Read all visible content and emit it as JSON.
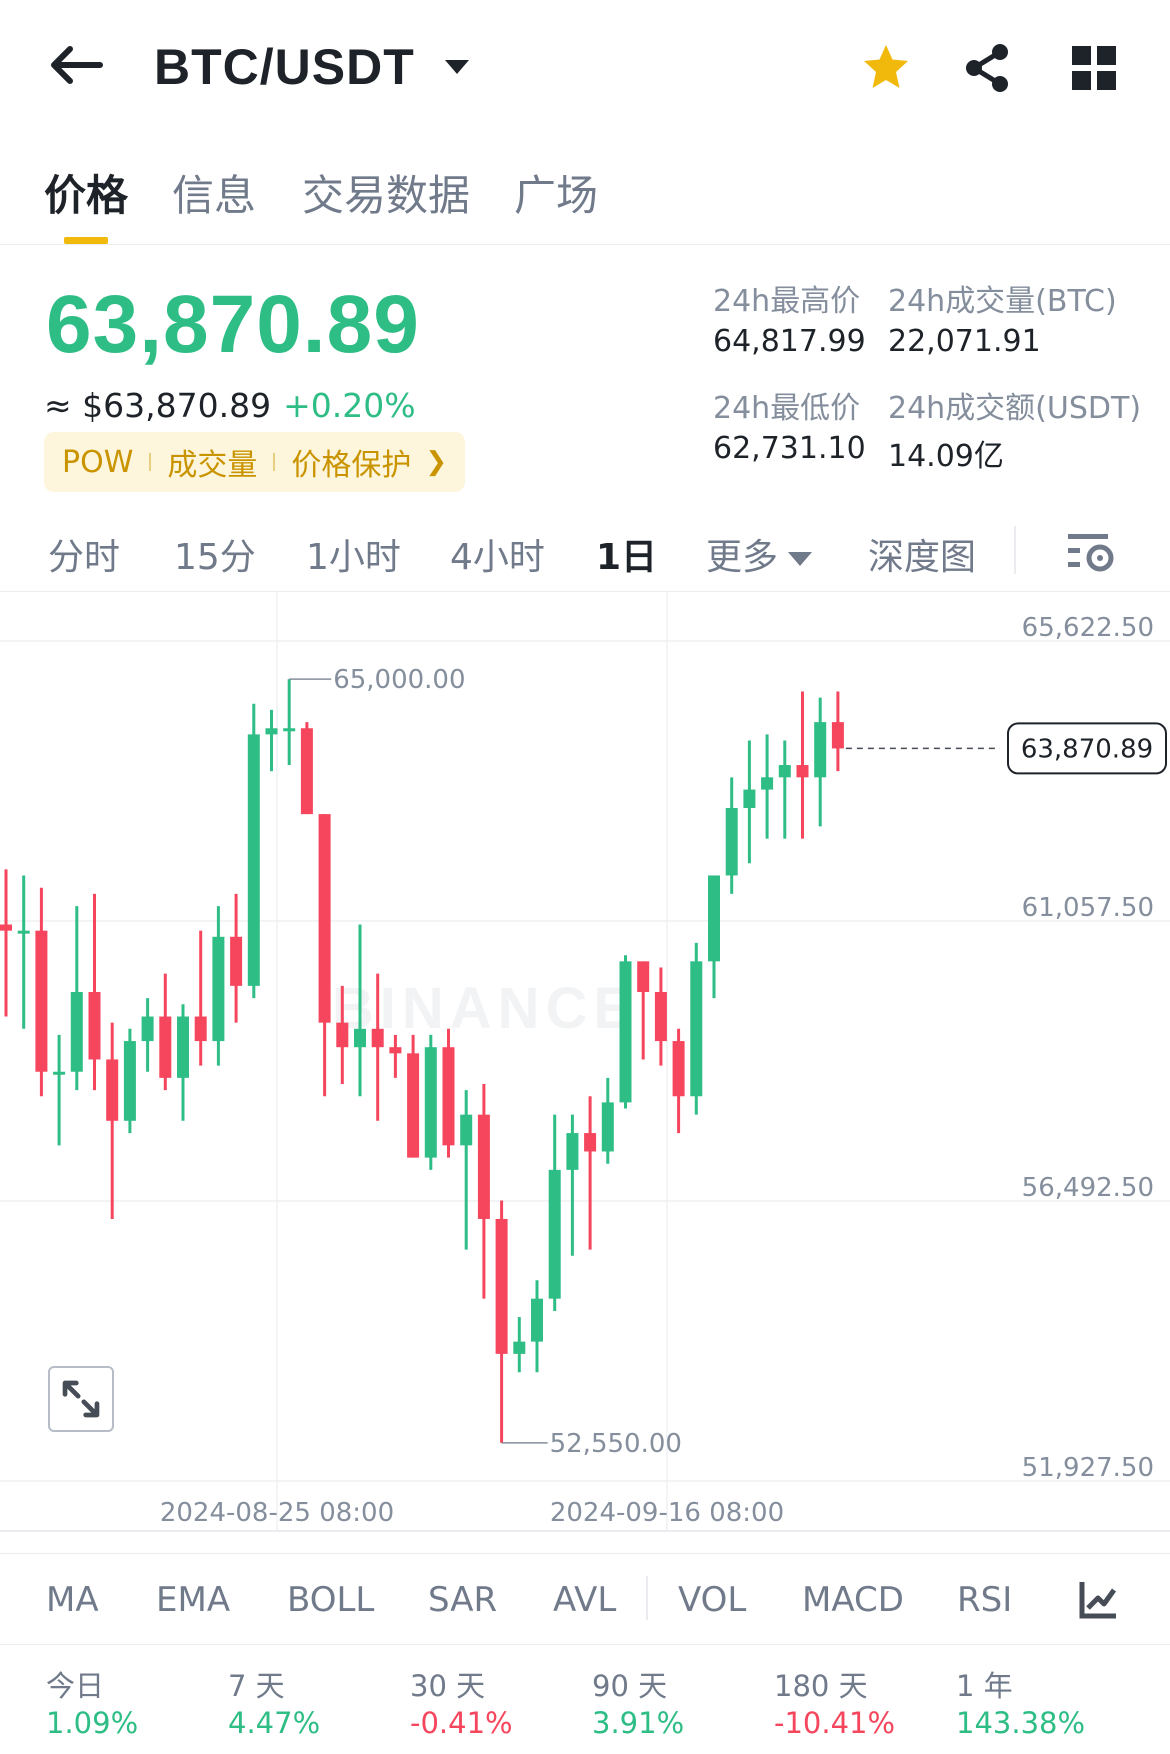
{
  "header": {
    "pair": "BTC/USDT",
    "icons": [
      "back-arrow-icon",
      "caret-down-icon",
      "star-icon",
      "share-icon",
      "grid-icon"
    ],
    "star_color": "#f0b90b"
  },
  "tabs": [
    {
      "label": "价格",
      "active": true
    },
    {
      "label": "信息",
      "active": false
    },
    {
      "label": "交易数据",
      "active": false
    },
    {
      "label": "广场",
      "active": false
    }
  ],
  "price": {
    "last": "63,870.89",
    "fiat": "≈ $63,870.89",
    "change": "+0.20%",
    "tags": [
      "POW",
      "成交量",
      "价格保护"
    ]
  },
  "stats": {
    "high_label": "24h最高价",
    "high_value": "64,817.99",
    "vol_btc_label": "24h成交量(BTC)",
    "vol_btc_value": "22,071.91",
    "low_label": "24h最低价",
    "low_value": "62,731.10",
    "vol_usdt_label": "24h成交额(USDT)",
    "vol_usdt_value": "14.09亿"
  },
  "intervals": [
    "分时",
    "15分",
    "1小时",
    "4小时",
    "1日",
    "更多",
    "深度图"
  ],
  "active_interval": "1日",
  "colors": {
    "up": "#2ebd85",
    "down": "#f6465d",
    "accent": "#f0b90b"
  },
  "chart": {
    "watermark": "BINANCE",
    "price_labels": [
      "65,622.50",
      "61,057.50",
      "56,492.50",
      "51,927.50"
    ],
    "date_labels": [
      "2024-08-25 08:00",
      "2024-09-16 08:00"
    ],
    "high_marker": "65,000.00",
    "low_marker": "52,550.00",
    "current_price": "63,870.89"
  },
  "chart_data": {
    "type": "candlestick",
    "interval": "1日",
    "ylim": [
      51927.5,
      65622.5
    ],
    "y_ticks": [
      65622.5,
      61057.5,
      56492.5,
      51927.5
    ],
    "x_ticks": [
      "2024-08-25 08:00",
      "2024-09-16 08:00"
    ],
    "high_annotation": 65000.0,
    "low_annotation": 52550.0,
    "last_price": 63870.89,
    "candles": [
      {
        "o": 61000,
        "h": 61900,
        "l": 59500,
        "c": 60900
      },
      {
        "o": 60900,
        "h": 61800,
        "l": 59300,
        "c": 60900
      },
      {
        "o": 60900,
        "h": 61600,
        "l": 58200,
        "c": 58600
      },
      {
        "o": 58600,
        "h": 59200,
        "l": 57400,
        "c": 58600
      },
      {
        "o": 58600,
        "h": 61300,
        "l": 58300,
        "c": 59900
      },
      {
        "o": 59900,
        "h": 61500,
        "l": 58300,
        "c": 58800
      },
      {
        "o": 58800,
        "h": 59400,
        "l": 56200,
        "c": 57800
      },
      {
        "o": 57800,
        "h": 59300,
        "l": 57600,
        "c": 59100
      },
      {
        "o": 59100,
        "h": 59800,
        "l": 58600,
        "c": 59500
      },
      {
        "o": 59500,
        "h": 60200,
        "l": 58300,
        "c": 58500
      },
      {
        "o": 58500,
        "h": 59700,
        "l": 57800,
        "c": 59500
      },
      {
        "o": 59500,
        "h": 60900,
        "l": 58700,
        "c": 59100
      },
      {
        "o": 59100,
        "h": 61300,
        "l": 58700,
        "c": 60800
      },
      {
        "o": 60800,
        "h": 61500,
        "l": 59400,
        "c": 60000
      },
      {
        "o": 60000,
        "h": 64600,
        "l": 59800,
        "c": 64100
      },
      {
        "o": 64100,
        "h": 64500,
        "l": 63500,
        "c": 64200
      },
      {
        "o": 64200,
        "h": 65000,
        "l": 63600,
        "c": 64200
      },
      {
        "o": 64200,
        "h": 64300,
        "l": 62800,
        "c": 62800
      },
      {
        "o": 62800,
        "h": 62500,
        "l": 58200,
        "c": 59400
      },
      {
        "o": 59400,
        "h": 60000,
        "l": 58400,
        "c": 59000
      },
      {
        "o": 59000,
        "h": 61000,
        "l": 58200,
        "c": 59300
      },
      {
        "o": 59300,
        "h": 60200,
        "l": 57800,
        "c": 59000
      },
      {
        "o": 59000,
        "h": 59200,
        "l": 58500,
        "c": 58900
      },
      {
        "o": 58900,
        "h": 59200,
        "l": 57500,
        "c": 57200
      },
      {
        "o": 57200,
        "h": 59200,
        "l": 57000,
        "c": 59000
      },
      {
        "o": 59000,
        "h": 59300,
        "l": 57200,
        "c": 57400
      },
      {
        "o": 57400,
        "h": 58300,
        "l": 55700,
        "c": 57900
      },
      {
        "o": 57900,
        "h": 58400,
        "l": 54900,
        "c": 56200
      },
      {
        "o": 56200,
        "h": 56500,
        "l": 52550,
        "c": 54000
      },
      {
        "o": 54000,
        "h": 54600,
        "l": 53700,
        "c": 54200
      },
      {
        "o": 54200,
        "h": 55200,
        "l": 53700,
        "c": 54900
      },
      {
        "o": 54900,
        "h": 57900,
        "l": 54700,
        "c": 57000
      },
      {
        "o": 57000,
        "h": 57900,
        "l": 55600,
        "c": 57600
      },
      {
        "o": 57600,
        "h": 58200,
        "l": 55700,
        "c": 57300
      },
      {
        "o": 57300,
        "h": 58500,
        "l": 57100,
        "c": 58100
      },
      {
        "o": 58100,
        "h": 60500,
        "l": 58000,
        "c": 60400
      },
      {
        "o": 60400,
        "h": 60400,
        "l": 58800,
        "c": 59900
      },
      {
        "o": 59900,
        "h": 60300,
        "l": 58700,
        "c": 59100
      },
      {
        "o": 59100,
        "h": 59300,
        "l": 57600,
        "c": 58200
      },
      {
        "o": 58200,
        "h": 60700,
        "l": 57900,
        "c": 60400
      },
      {
        "o": 60400,
        "h": 61700,
        "l": 59800,
        "c": 61800
      },
      {
        "o": 61800,
        "h": 63400,
        "l": 61500,
        "c": 62900
      },
      {
        "o": 62900,
        "h": 64000,
        "l": 62000,
        "c": 63200
      },
      {
        "o": 63200,
        "h": 64100,
        "l": 62400,
        "c": 63400
      },
      {
        "o": 63400,
        "h": 64000,
        "l": 62400,
        "c": 63600
      },
      {
        "o": 63600,
        "h": 64800,
        "l": 62400,
        "c": 63400
      },
      {
        "o": 63400,
        "h": 64700,
        "l": 62600,
        "c": 64300
      },
      {
        "o": 64300,
        "h": 64800,
        "l": 63500,
        "c": 63870.89
      }
    ]
  },
  "indicators": [
    "MA",
    "EMA",
    "BOLL",
    "SAR",
    "AVL",
    "VOL",
    "MACD",
    "RSI"
  ],
  "performance": [
    {
      "label": "今日",
      "value": "1.09%",
      "dir": "up"
    },
    {
      "label": "7 天",
      "value": "4.47%",
      "dir": "up"
    },
    {
      "label": "30 天",
      "value": "-0.41%",
      "dir": "down"
    },
    {
      "label": "90 天",
      "value": "3.91%",
      "dir": "up"
    },
    {
      "label": "180 天",
      "value": "-10.41%",
      "dir": "down"
    },
    {
      "label": "1 年",
      "value": "143.38%",
      "dir": "up"
    }
  ]
}
